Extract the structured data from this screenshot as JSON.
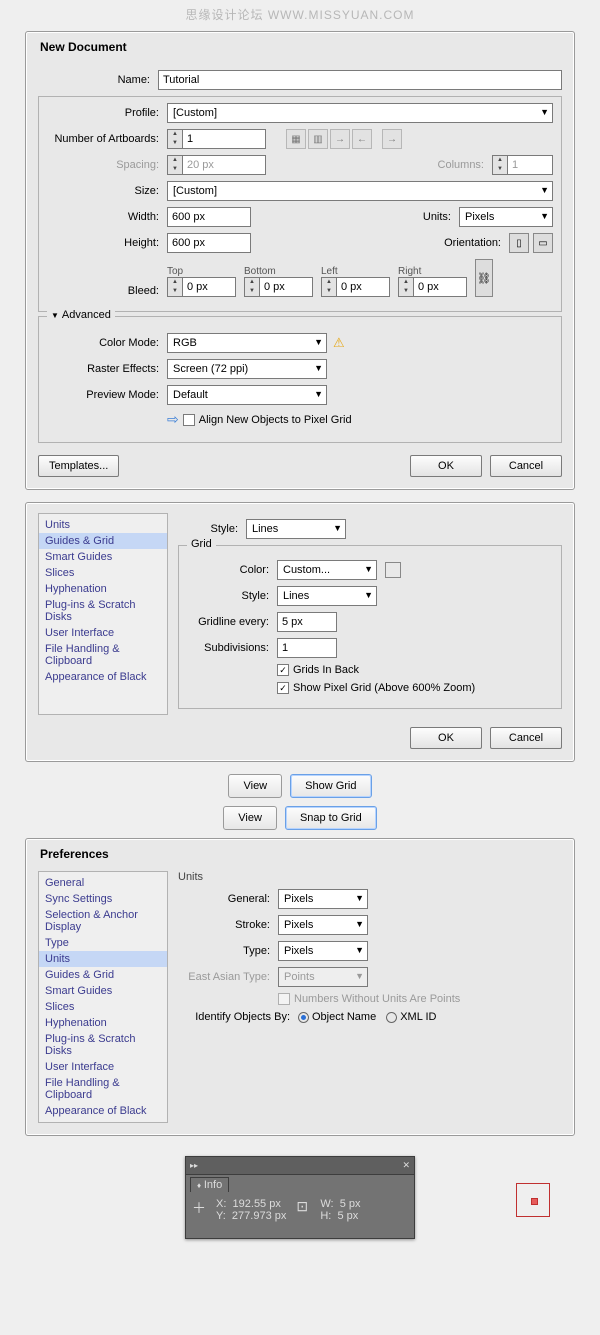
{
  "watermark": "思缘设计论坛  WWW.MISSYUAN.COM",
  "newDoc": {
    "title": "New Document",
    "nameLabel": "Name:",
    "nameValue": "Tutorial",
    "profileLabel": "Profile:",
    "profileValue": "[Custom]",
    "artboardsLabel": "Number of Artboards:",
    "artboardsValue": "1",
    "spacingLabel": "Spacing:",
    "spacingValue": "20 px",
    "columnsLabel": "Columns:",
    "columnsValue": "1",
    "sizeLabel": "Size:",
    "sizeValue": "[Custom]",
    "widthLabel": "Width:",
    "widthValue": "600 px",
    "unitsLabel": "Units:",
    "unitsValue": "Pixels",
    "heightLabel": "Height:",
    "heightValue": "600 px",
    "orientLabel": "Orientation:",
    "bleedLabel": "Bleed:",
    "bleed": {
      "top": "0 px",
      "bottom": "0 px",
      "left": "0 px",
      "right": "0 px",
      "hTop": "Top",
      "hBottom": "Bottom",
      "hLeft": "Left",
      "hRight": "Right"
    },
    "advanced": "Advanced",
    "colorModeLabel": "Color Mode:",
    "colorModeValue": "RGB",
    "rasterLabel": "Raster Effects:",
    "rasterValue": "Screen (72 ppi)",
    "previewLabel": "Preview Mode:",
    "previewValue": "Default",
    "alignLabel": "Align New Objects to Pixel Grid",
    "templates": "Templates...",
    "ok": "OK",
    "cancel": "Cancel"
  },
  "prefs1": {
    "side": [
      "Units",
      "Guides & Grid",
      "Smart Guides",
      "Slices",
      "Hyphenation",
      "Plug-ins & Scratch Disks",
      "User Interface",
      "File Handling & Clipboard",
      "Appearance of Black"
    ],
    "sideSel": 1,
    "styleLabel": "Style:",
    "styleValue": "Lines",
    "gridTitle": "Grid",
    "colorLabel": "Color:",
    "colorValue": "Custom...",
    "gridStyleLabel": "Style:",
    "gridStyleValue": "Lines",
    "gridEveryLabel": "Gridline every:",
    "gridEveryValue": "5 px",
    "subdivLabel": "Subdivisions:",
    "subdivValue": "1",
    "gridsBack": "Grids In Back",
    "showPixelGrid": "Show Pixel Grid (Above 600% Zoom)",
    "ok": "OK",
    "cancel": "Cancel"
  },
  "menu1": {
    "view": "View",
    "showGrid": "Show Grid"
  },
  "menu2": {
    "view": "View",
    "snapGrid": "Snap to Grid"
  },
  "prefs2": {
    "title": "Preferences",
    "side": [
      "General",
      "Sync Settings",
      "Selection & Anchor Display",
      "Type",
      "Units",
      "Guides & Grid",
      "Smart Guides",
      "Slices",
      "Hyphenation",
      "Plug-ins & Scratch Disks",
      "User Interface",
      "File Handling & Clipboard",
      "Appearance of Black"
    ],
    "sideSel": 4,
    "sectionTitle": "Units",
    "generalLabel": "General:",
    "generalValue": "Pixels",
    "strokeLabel": "Stroke:",
    "strokeValue": "Pixels",
    "typeLabel": "Type:",
    "typeValue": "Pixels",
    "eastAsianLabel": "East Asian Type:",
    "eastAsianValue": "Points",
    "noUnits": "Numbers Without Units Are Points",
    "identifyLabel": "Identify Objects By:",
    "optName": "Object Name",
    "optXml": "XML ID"
  },
  "info": {
    "title": "Info",
    "x": "192.55 px",
    "y": "277.973 px",
    "w": "5 px",
    "h": "5 px",
    "xL": "X:",
    "yL": "Y:",
    "wL": "W:",
    "hL": "H:"
  }
}
